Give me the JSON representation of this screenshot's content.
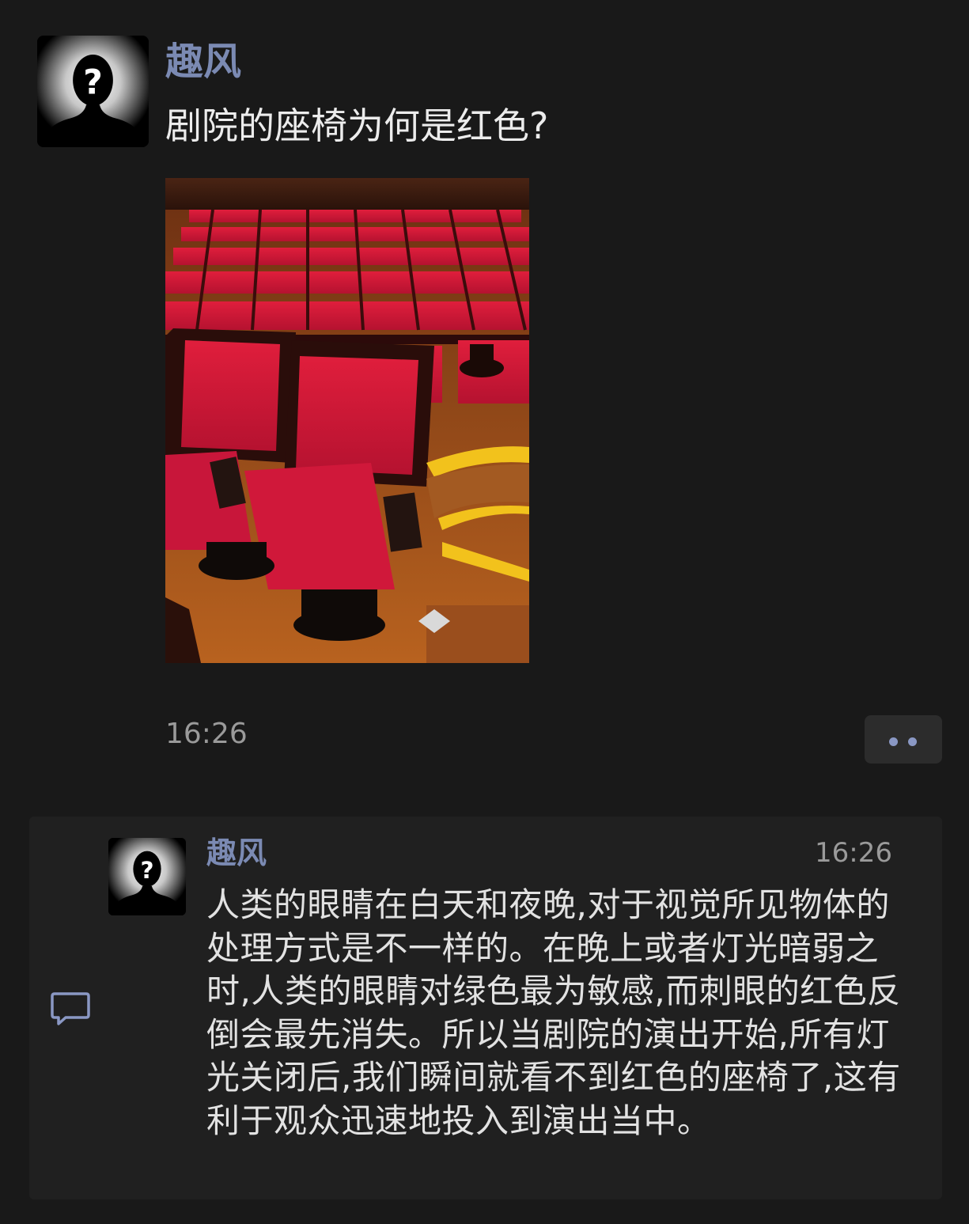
{
  "post": {
    "author": "趣风",
    "text": "剧院的座椅为何是红色?",
    "time": "16:26",
    "avatar_icon": "anonymous-person-icon",
    "photo_subject": "red-theater-seats"
  },
  "comment": {
    "author": "趣风",
    "time": "16:26",
    "text": "人类的眼睛在白天和夜晚,对于视觉所见物体的处理方式是不一样的。在晚上或者灯光暗弱之时,人类的眼睛对绿色最为敏感,而刺眼的红色反倒会最先消失。所以当剧院的演出开始,所有灯光关闭后,我们瞬间就看不到红色的座椅了,这有利于观众迅速地投入到演出当中。",
    "icon": "comment-icon"
  },
  "colors": {
    "background": "#191919",
    "panel": "#202020",
    "author_name": "#7b8ab3",
    "accent_dots": "#8a98c4",
    "timestamp": "#9a9a9a"
  }
}
